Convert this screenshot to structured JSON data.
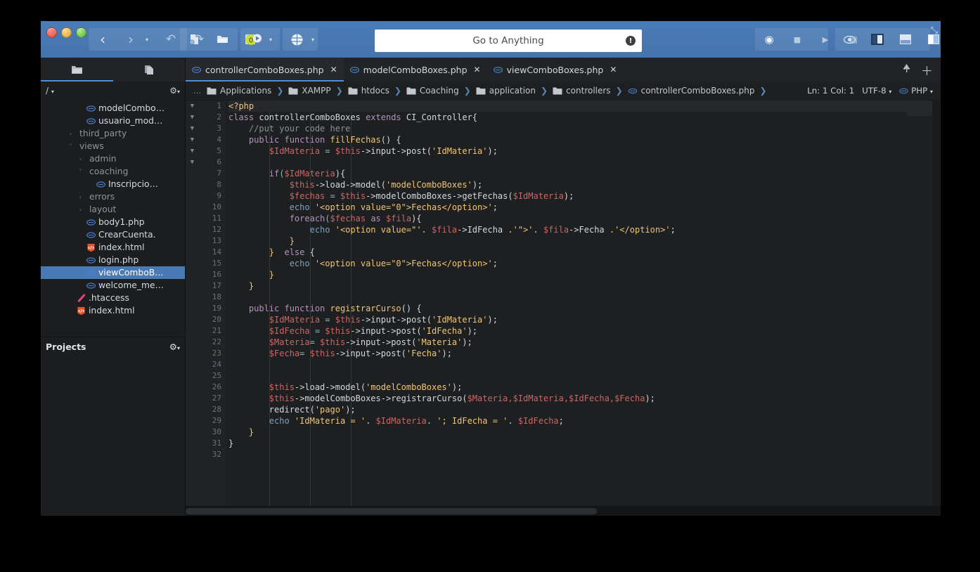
{
  "app": {
    "search_placeholder": "Go to Anything",
    "info_glyph": "!"
  },
  "titlebar": {
    "nav": {
      "back": "‹",
      "forward": "›",
      "caret": "▾",
      "undo": "↶",
      "redo": "↷"
    },
    "file_actions": {
      "new_file": "new-file",
      "open_folder": "open-folder",
      "save": "save",
      "preview": "0",
      "browser": "globe"
    },
    "macro": {
      "record": "◉",
      "stop": "■",
      "play": "▶",
      "save": "▤"
    },
    "layout": {
      "eye": "◉",
      "pane_left": "left",
      "pane_bottom": "bottom",
      "pane_right": "right",
      "caret": "▾"
    },
    "resize_glyph": "⤡"
  },
  "left_tabs": [
    {
      "name": "places-tab",
      "icon": "folder-icon",
      "active": true
    },
    {
      "name": "file-tab",
      "icon": "document-icon",
      "active": false
    }
  ],
  "file_tabs": [
    {
      "label": "controllerComboBoxes.php",
      "active": true,
      "close": "✕"
    },
    {
      "label": "modelComboBoxes.php",
      "active": false,
      "close": "✕"
    },
    {
      "label": "viewComboBoxes.php",
      "active": false,
      "close": "✕"
    }
  ],
  "tab_bar_right": {
    "pin": "☂",
    "add": "＋"
  },
  "sidebar": {
    "path_label": "/",
    "path_caret": "▾",
    "gear": "⚙",
    "gear_caret": "▾",
    "footer_label": "Projects",
    "items": [
      {
        "label": "modelCombo…",
        "indent": 3,
        "type": "php",
        "arrow": "",
        "selected": false
      },
      {
        "label": "usuario_mod…",
        "indent": 3,
        "type": "php",
        "arrow": "",
        "selected": false
      },
      {
        "label": "third_party",
        "indent": 2,
        "type": "folder",
        "arrow": "›",
        "selected": false
      },
      {
        "label": "views",
        "indent": 2,
        "type": "folder",
        "arrow": "˅",
        "selected": false
      },
      {
        "label": "admin",
        "indent": 3,
        "type": "folder",
        "arrow": "›",
        "selected": false
      },
      {
        "label": "coaching",
        "indent": 3,
        "type": "folder",
        "arrow": "˅",
        "selected": false
      },
      {
        "label": "Inscripcio…",
        "indent": 4,
        "type": "php",
        "arrow": "",
        "selected": false
      },
      {
        "label": "errors",
        "indent": 3,
        "type": "folder",
        "arrow": "›",
        "selected": false
      },
      {
        "label": "layout",
        "indent": 3,
        "type": "folder",
        "arrow": "›",
        "selected": false
      },
      {
        "label": "body1.php",
        "indent": 3,
        "type": "php",
        "arrow": "",
        "selected": false
      },
      {
        "label": "CrearCuenta.",
        "indent": 3,
        "type": "php",
        "arrow": "",
        "selected": false
      },
      {
        "label": "index.html",
        "indent": 3,
        "type": "html",
        "arrow": "",
        "selected": false
      },
      {
        "label": "login.php",
        "indent": 3,
        "type": "php",
        "arrow": "",
        "selected": false
      },
      {
        "label": "viewComboB…",
        "indent": 3,
        "type": "php",
        "arrow": "",
        "selected": true
      },
      {
        "label": "welcome_me…",
        "indent": 3,
        "type": "php",
        "arrow": "",
        "selected": false
      },
      {
        "label": ".htaccess",
        "indent": 2,
        "type": "htaccess",
        "arrow": "",
        "selected": false
      },
      {
        "label": "index.html",
        "indent": 2,
        "type": "html",
        "arrow": "",
        "selected": false
      }
    ]
  },
  "breadcrumb": {
    "ellipsis": "…",
    "separator": "❯",
    "items": [
      {
        "label": "Applications",
        "type": "folder"
      },
      {
        "label": "XAMPP",
        "type": "folder"
      },
      {
        "label": "htdocs",
        "type": "folder"
      },
      {
        "label": "Coaching",
        "type": "folder"
      },
      {
        "label": "application",
        "type": "folder"
      },
      {
        "label": "controllers",
        "type": "folder"
      },
      {
        "label": "controllerComboBoxes.php",
        "type": "php"
      }
    ],
    "status": {
      "position": "Ln: 1 Col: 1",
      "encoding": "UTF-8",
      "encoding_caret": "▾",
      "language": "PHP",
      "language_caret": "▾"
    }
  },
  "editor": {
    "total_lines": 32,
    "current_line": 1,
    "fold_lines": [
      1,
      2,
      4,
      7,
      11,
      19
    ],
    "lines": [
      {
        "n": 1,
        "tokens": [
          {
            "t": "<?php",
            "c": "t-tag"
          }
        ]
      },
      {
        "n": 2,
        "tokens": [
          {
            "t": "class ",
            "c": "t-kw"
          },
          {
            "t": "controllerComboBoxes ",
            "c": "t-cls"
          },
          {
            "t": "extends ",
            "c": "t-kw"
          },
          {
            "t": "CI_Controller{",
            "c": "t-cls"
          }
        ]
      },
      {
        "n": 3,
        "tokens": [
          {
            "t": "    //put your code here",
            "c": "t-com"
          }
        ]
      },
      {
        "n": 4,
        "tokens": [
          {
            "t": "    ",
            "c": "t-pun"
          },
          {
            "t": "public function ",
            "c": "t-kw"
          },
          {
            "t": "fillFechas",
            "c": "t-fn"
          },
          {
            "t": "() {",
            "c": "t-pun"
          }
        ]
      },
      {
        "n": 5,
        "tokens": [
          {
            "t": "        ",
            "c": "t-pun"
          },
          {
            "t": "$IdMateria ",
            "c": "t-var"
          },
          {
            "t": "= ",
            "c": "t-op"
          },
          {
            "t": "$this",
            "c": "t-var"
          },
          {
            "t": "->input->post(",
            "c": "t-pun"
          },
          {
            "t": "'IdMateria'",
            "c": "t-str"
          },
          {
            "t": ");",
            "c": "t-pun"
          }
        ]
      },
      {
        "n": 6,
        "tokens": []
      },
      {
        "n": 7,
        "tokens": [
          {
            "t": "        ",
            "c": "t-pun"
          },
          {
            "t": "if",
            "c": "t-kw"
          },
          {
            "t": "(",
            "c": "t-op"
          },
          {
            "t": "$IdMateria",
            "c": "t-var"
          },
          {
            "t": "){",
            "c": "t-pun"
          }
        ]
      },
      {
        "n": 8,
        "tokens": [
          {
            "t": "            ",
            "c": "t-pun"
          },
          {
            "t": "$this",
            "c": "t-var"
          },
          {
            "t": "->load->model(",
            "c": "t-pun"
          },
          {
            "t": "'modelComboBoxes'",
            "c": "t-str"
          },
          {
            "t": ");",
            "c": "t-pun"
          }
        ]
      },
      {
        "n": 9,
        "tokens": [
          {
            "t": "            ",
            "c": "t-pun"
          },
          {
            "t": "$fechas ",
            "c": "t-var"
          },
          {
            "t": "= ",
            "c": "t-op"
          },
          {
            "t": "$this",
            "c": "t-var"
          },
          {
            "t": "->modelComboBoxes->getFechas(",
            "c": "t-pun"
          },
          {
            "t": "$IdMateria",
            "c": "t-var"
          },
          {
            "t": ");",
            "c": "t-pun"
          }
        ]
      },
      {
        "n": 10,
        "tokens": [
          {
            "t": "            ",
            "c": "t-pun"
          },
          {
            "t": "echo ",
            "c": "t-echo"
          },
          {
            "t": "'<option value=\"0\">Fechas</option>'",
            "c": "t-str"
          },
          {
            "t": ";",
            "c": "t-pun"
          }
        ]
      },
      {
        "n": 11,
        "tokens": [
          {
            "t": "            ",
            "c": "t-pun"
          },
          {
            "t": "foreach",
            "c": "t-kw"
          },
          {
            "t": "(",
            "c": "t-op"
          },
          {
            "t": "$fechas ",
            "c": "t-var"
          },
          {
            "t": "as ",
            "c": "t-kw"
          },
          {
            "t": "$fila",
            "c": "t-var"
          },
          {
            "t": "){",
            "c": "t-pun"
          }
        ]
      },
      {
        "n": 12,
        "tokens": [
          {
            "t": "                ",
            "c": "t-pun"
          },
          {
            "t": "echo ",
            "c": "t-echo"
          },
          {
            "t": "'<option value=\"'",
            "c": "t-str"
          },
          {
            "t": ". ",
            "c": "t-pun"
          },
          {
            "t": "$fila",
            "c": "t-var"
          },
          {
            "t": "->IdFecha ",
            "c": "t-pun"
          },
          {
            "t": ".'\">'",
            "c": "t-str"
          },
          {
            "t": ". ",
            "c": "t-pun"
          },
          {
            "t": "$fila",
            "c": "t-var"
          },
          {
            "t": "->Fecha ",
            "c": "t-pun"
          },
          {
            "t": ".'</option>'",
            "c": "t-str"
          },
          {
            "t": ";",
            "c": "t-pun"
          }
        ]
      },
      {
        "n": 13,
        "tokens": [
          {
            "t": "            }",
            "c": "t-str"
          }
        ]
      },
      {
        "n": 14,
        "tokens": [
          {
            "t": "        } ",
            "c": "t-str"
          },
          {
            "t": " else ",
            "c": "t-kw"
          },
          {
            "t": "{",
            "c": "t-pun"
          }
        ]
      },
      {
        "n": 15,
        "tokens": [
          {
            "t": "            ",
            "c": "t-pun"
          },
          {
            "t": "echo ",
            "c": "t-echo"
          },
          {
            "t": "'<option value=\"0\">Fechas</option>'",
            "c": "t-str"
          },
          {
            "t": ";",
            "c": "t-pun"
          }
        ]
      },
      {
        "n": 16,
        "tokens": [
          {
            "t": "        }",
            "c": "t-str"
          }
        ]
      },
      {
        "n": 17,
        "tokens": [
          {
            "t": "    }",
            "c": "t-str"
          }
        ]
      },
      {
        "n": 18,
        "tokens": []
      },
      {
        "n": 19,
        "tokens": [
          {
            "t": "    ",
            "c": "t-pun"
          },
          {
            "t": "public function ",
            "c": "t-kw"
          },
          {
            "t": "registrarCurso",
            "c": "t-fn"
          },
          {
            "t": "() {",
            "c": "t-pun"
          }
        ]
      },
      {
        "n": 20,
        "tokens": [
          {
            "t": "        ",
            "c": "t-pun"
          },
          {
            "t": "$IdMateria ",
            "c": "t-var"
          },
          {
            "t": "= ",
            "c": "t-op"
          },
          {
            "t": "$this",
            "c": "t-var"
          },
          {
            "t": "->input->post(",
            "c": "t-pun"
          },
          {
            "t": "'IdMateria'",
            "c": "t-str"
          },
          {
            "t": ");",
            "c": "t-pun"
          }
        ]
      },
      {
        "n": 21,
        "tokens": [
          {
            "t": "        ",
            "c": "t-pun"
          },
          {
            "t": "$IdFecha ",
            "c": "t-var"
          },
          {
            "t": "= ",
            "c": "t-op"
          },
          {
            "t": "$this",
            "c": "t-var"
          },
          {
            "t": "->input->post(",
            "c": "t-pun"
          },
          {
            "t": "'IdFecha'",
            "c": "t-str"
          },
          {
            "t": ");",
            "c": "t-pun"
          }
        ]
      },
      {
        "n": 22,
        "tokens": [
          {
            "t": "        ",
            "c": "t-pun"
          },
          {
            "t": "$Materia",
            "c": "t-var"
          },
          {
            "t": "= ",
            "c": "t-op"
          },
          {
            "t": "$this",
            "c": "t-var"
          },
          {
            "t": "->input->post(",
            "c": "t-pun"
          },
          {
            "t": "'Materia'",
            "c": "t-str"
          },
          {
            "t": ");",
            "c": "t-pun"
          }
        ]
      },
      {
        "n": 23,
        "tokens": [
          {
            "t": "        ",
            "c": "t-pun"
          },
          {
            "t": "$Fecha",
            "c": "t-var"
          },
          {
            "t": "= ",
            "c": "t-op"
          },
          {
            "t": "$this",
            "c": "t-var"
          },
          {
            "t": "->input->post(",
            "c": "t-pun"
          },
          {
            "t": "'Fecha'",
            "c": "t-str"
          },
          {
            "t": ");",
            "c": "t-pun"
          }
        ]
      },
      {
        "n": 24,
        "tokens": []
      },
      {
        "n": 25,
        "tokens": []
      },
      {
        "n": 26,
        "tokens": [
          {
            "t": "        ",
            "c": "t-pun"
          },
          {
            "t": "$this",
            "c": "t-var"
          },
          {
            "t": "->load->model(",
            "c": "t-pun"
          },
          {
            "t": "'modelComboBoxes'",
            "c": "t-str"
          },
          {
            "t": ");",
            "c": "t-pun"
          }
        ]
      },
      {
        "n": 27,
        "tokens": [
          {
            "t": "        ",
            "c": "t-pun"
          },
          {
            "t": "$this",
            "c": "t-var"
          },
          {
            "t": "->modelComboBoxes->registrarCurso(",
            "c": "t-pun"
          },
          {
            "t": "$Materia,$IdMateria,$IdFecha,$Fecha",
            "c": "t-var"
          },
          {
            "t": ");",
            "c": "t-pun"
          }
        ]
      },
      {
        "n": 28,
        "tokens": [
          {
            "t": "        redirect(",
            "c": "t-pun"
          },
          {
            "t": "'pago'",
            "c": "t-str"
          },
          {
            "t": ");",
            "c": "t-pun"
          }
        ]
      },
      {
        "n": 29,
        "tokens": [
          {
            "t": "        ",
            "c": "t-pun"
          },
          {
            "t": "echo ",
            "c": "t-echo"
          },
          {
            "t": "'IdMateria = '",
            "c": "t-str"
          },
          {
            "t": ". ",
            "c": "t-pun"
          },
          {
            "t": "$IdMateria",
            "c": "t-var"
          },
          {
            "t": ". ",
            "c": "t-pun"
          },
          {
            "t": "'; IdFecha = '",
            "c": "t-str"
          },
          {
            "t": ". ",
            "c": "t-pun"
          },
          {
            "t": "$IdFecha",
            "c": "t-var"
          },
          {
            "t": ";",
            "c": "t-pun"
          }
        ]
      },
      {
        "n": 30,
        "tokens": [
          {
            "t": "    }",
            "c": "t-str"
          }
        ]
      },
      {
        "n": 31,
        "tokens": [
          {
            "t": "}",
            "c": "t-pun"
          }
        ]
      },
      {
        "n": 32,
        "tokens": []
      }
    ]
  },
  "colors": {
    "titlebar": "#4a7ab5",
    "accent": "#4a90d9",
    "editor_bg": "#1d1f21",
    "gutter_bg": "#202225",
    "sidebar_bg": "#1b1d1f",
    "selection": "#4a7ab5",
    "php_icon": "#3f7fd0",
    "html_icon": "#e44d26"
  }
}
